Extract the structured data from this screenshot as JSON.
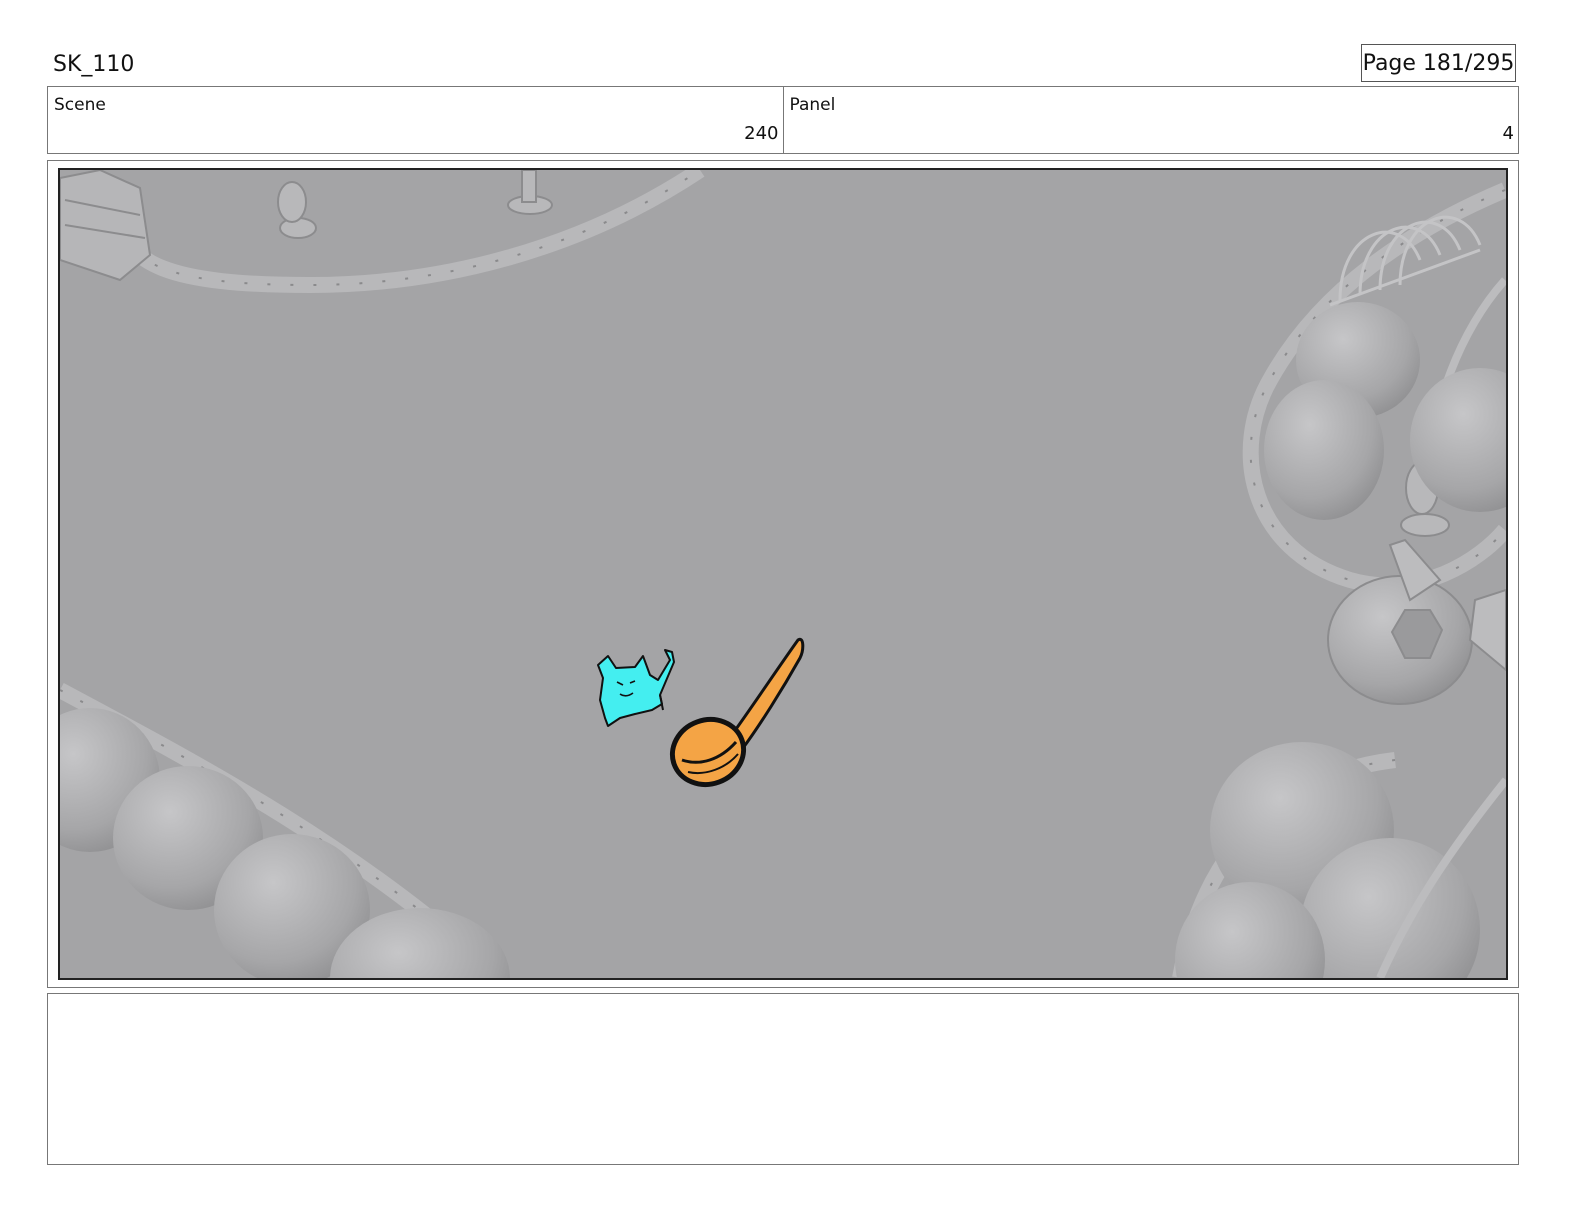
{
  "header": {
    "title": "SK_110",
    "page": "Page 181/295"
  },
  "info": {
    "scene_label": "Scene",
    "scene_value": "240",
    "panel_label": "Panel",
    "panel_value": "4"
  },
  "panel": {
    "colors": {
      "ground": "#a4a4a6",
      "props": "#b4b4b6",
      "character": "#44eef0",
      "spoon": "#f4a445",
      "outline": "#111111"
    }
  },
  "notes": {
    "text": ""
  }
}
